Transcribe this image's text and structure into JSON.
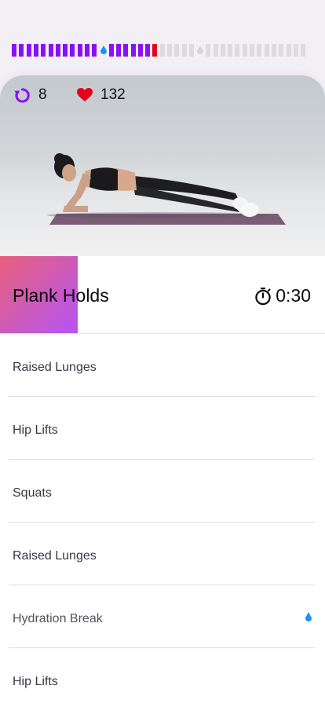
{
  "progress": {
    "segments": [
      "done",
      "done",
      "done",
      "done",
      "done",
      "done",
      "done",
      "done",
      "done",
      "done",
      "done",
      "done",
      "drop-done",
      "done",
      "done",
      "done",
      "done",
      "done",
      "done",
      "current",
      "todo",
      "todo",
      "todo",
      "todo",
      "todo",
      "drop-todo",
      "todo",
      "todo",
      "todo",
      "todo",
      "todo",
      "todo",
      "todo",
      "todo",
      "todo",
      "todo",
      "todo",
      "todo",
      "todo",
      "todo"
    ]
  },
  "stats": {
    "rounds": "8",
    "heart_rate": "132"
  },
  "current": {
    "title": "Plank Holds",
    "timer": "0:30",
    "elapsed_fraction": 0.24
  },
  "list": [
    {
      "label": "Raised Lunges",
      "type": "exercise"
    },
    {
      "label": "Hip Lifts",
      "type": "exercise"
    },
    {
      "label": "Squats",
      "type": "exercise"
    },
    {
      "label": "Raised Lunges",
      "type": "exercise"
    },
    {
      "label": "Hydration Break",
      "type": "break",
      "icon": "water-drop-icon"
    },
    {
      "label": "Hip Lifts",
      "type": "exercise"
    }
  ],
  "colors": {
    "accent": "#8a10f5",
    "current": "#e8001c",
    "heart": "#e8001c",
    "water": "#1e90ff"
  }
}
